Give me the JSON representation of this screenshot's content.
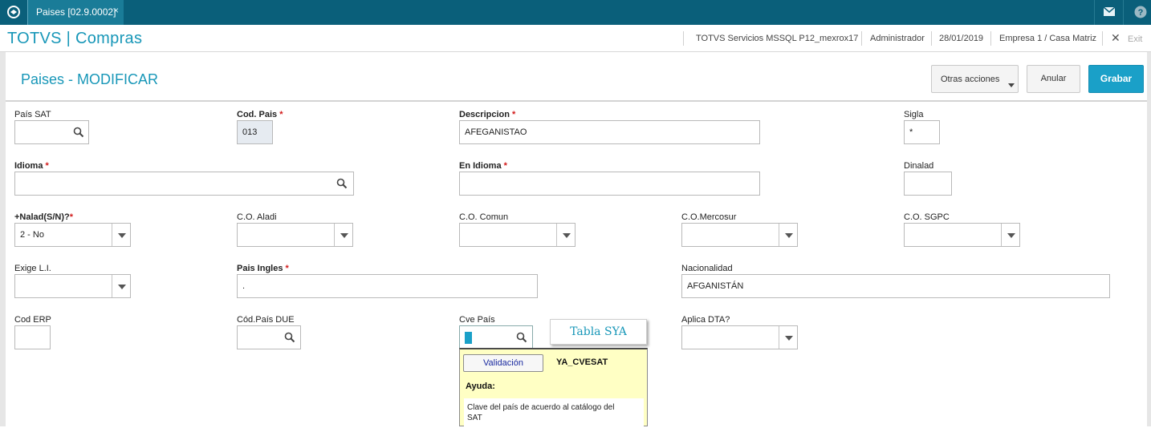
{
  "topbar": {
    "tab_label": "Paises [02.9.0002]",
    "tab_close": "×",
    "icons": {
      "logo": "totvs-logo-icon",
      "mail": "mail-icon",
      "help": "help-icon"
    }
  },
  "header": {
    "app_title": "TOTVS | Compras",
    "server": "TOTVS Servicios MSSQL P12_mexrox17",
    "user": "Administrador",
    "date": "28/01/2019",
    "company": "Empresa 1 / Casa Matriz",
    "exit_label": "Exit"
  },
  "toolbar": {
    "page_title": "Paises - MODIFICAR",
    "otras_acciones_label": "Otras acciones",
    "anular_label": "Anular",
    "grabar_label": "Grabar"
  },
  "form": {
    "pais_sat": {
      "label": "País SAT",
      "value": ""
    },
    "cod_pais": {
      "label": "Cod. Pais",
      "value": "013"
    },
    "descripcion": {
      "label": "Descripcion",
      "value": "AFEGANISTAO"
    },
    "sigla": {
      "label": "Sigla",
      "value": "*"
    },
    "idioma": {
      "label": "Idioma",
      "value": ""
    },
    "en_idioma": {
      "label": "En Idioma",
      "value": ""
    },
    "dinalad": {
      "label": "Dinalad",
      "value": ""
    },
    "nalad": {
      "label": "+Nalad(S/N)?",
      "value": "2 - No"
    },
    "co_aladi": {
      "label": "C.O. Aladi",
      "value": ""
    },
    "co_comun": {
      "label": "C.O. Comun",
      "value": ""
    },
    "co_mercosur": {
      "label": "C.O.Mercosur",
      "value": ""
    },
    "co_sgpc": {
      "label": "C.O. SGPC",
      "value": ""
    },
    "exige_li": {
      "label": "Exige L.I.",
      "value": ""
    },
    "pais_ingles": {
      "label": "Pais Ingles",
      "value": "."
    },
    "nacionalidad": {
      "label": "Nacionalidad",
      "value": "AFGANISTÁN"
    },
    "cod_erp": {
      "label": "Cod ERP",
      "value": ""
    },
    "cod_pais_due": {
      "label": "Cód.País DUE",
      "value": ""
    },
    "cve_pais": {
      "label": "Cve País",
      "value": ""
    },
    "aplica_dta": {
      "label": "Aplica DTA?",
      "value": ""
    },
    "required_mark": "*"
  },
  "help": {
    "tooltip_title": "Tabla SYA",
    "validacion_label": "Validación",
    "field_code": "YA_CVESAT",
    "ayuda_label": "Ayuda:",
    "text": "Clave del país de acuerdo al catálogo del SAT"
  },
  "colors": {
    "topbar": "#0a5f7a",
    "accent": "#1897b8",
    "primary_button": "#1aa0c8",
    "required": "#d21a1a",
    "help_bg": "#ffffc4"
  }
}
